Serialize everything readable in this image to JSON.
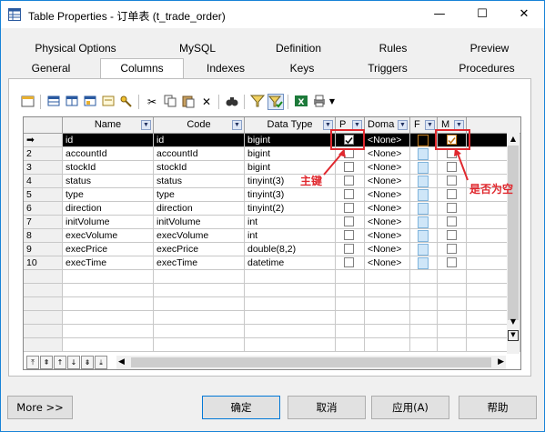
{
  "window": {
    "title": "Table Properties - 订单表 (t_trade_order)",
    "minimize": "—",
    "maximize": "☐",
    "close": "✕"
  },
  "tabs_top": [
    "Physical Options",
    "MySQL",
    "Definition",
    "Rules",
    "Preview"
  ],
  "tabs_bottom": [
    "General",
    "Columns",
    "Indexes",
    "Keys",
    "Triggers",
    "Procedures"
  ],
  "active_tab": "Columns",
  "grid": {
    "headers": {
      "name": "Name",
      "code": "Code",
      "type": "Data Type",
      "p": "P",
      "domain": "Doma",
      "f": "F",
      "m": "M"
    },
    "rows": [
      {
        "num": "➡",
        "name": "id",
        "code": "id",
        "type": "bigint",
        "domain": "<None>",
        "p": true,
        "m": true
      },
      {
        "num": "2",
        "name": "accountId",
        "code": "accountId",
        "type": "bigint",
        "domain": "<None>",
        "p": false,
        "m": false
      },
      {
        "num": "3",
        "name": "stockId",
        "code": "stockId",
        "type": "bigint",
        "domain": "<None>",
        "p": false,
        "m": false
      },
      {
        "num": "4",
        "name": "status",
        "code": "status",
        "type": "tinyint(3)",
        "domain": "<None>",
        "p": false,
        "m": false
      },
      {
        "num": "5",
        "name": "type",
        "code": "type",
        "type": "tinyint(3)",
        "domain": "<None>",
        "p": false,
        "m": false
      },
      {
        "num": "6",
        "name": "direction",
        "code": "direction",
        "type": "tinyint(2)",
        "domain": "<None>",
        "p": false,
        "m": false
      },
      {
        "num": "7",
        "name": "initVolume",
        "code": "initVolume",
        "type": "int",
        "domain": "<None>",
        "p": false,
        "m": false
      },
      {
        "num": "8",
        "name": "execVolume",
        "code": "execVolume",
        "type": "int",
        "domain": "<None>",
        "p": false,
        "m": false
      },
      {
        "num": "9",
        "name": "execPrice",
        "code": "execPrice",
        "type": "double(8,2)",
        "domain": "<None>",
        "p": false,
        "m": false
      },
      {
        "num": "10",
        "name": "execTime",
        "code": "execTime",
        "type": "datetime",
        "domain": "<None>",
        "p": false,
        "m": false
      }
    ],
    "empty_rows": 6
  },
  "annotations": {
    "primary_key": "主键",
    "nullable": "是否为空"
  },
  "buttons": {
    "more": "More >>",
    "ok": "确定",
    "cancel": "取消",
    "apply": "应用(A)",
    "help": "帮助"
  },
  "colors": {
    "accent": "#1883d7",
    "annotation": "#e0282e",
    "selected_row": "#000000",
    "f_box": "#cfe6f8"
  }
}
